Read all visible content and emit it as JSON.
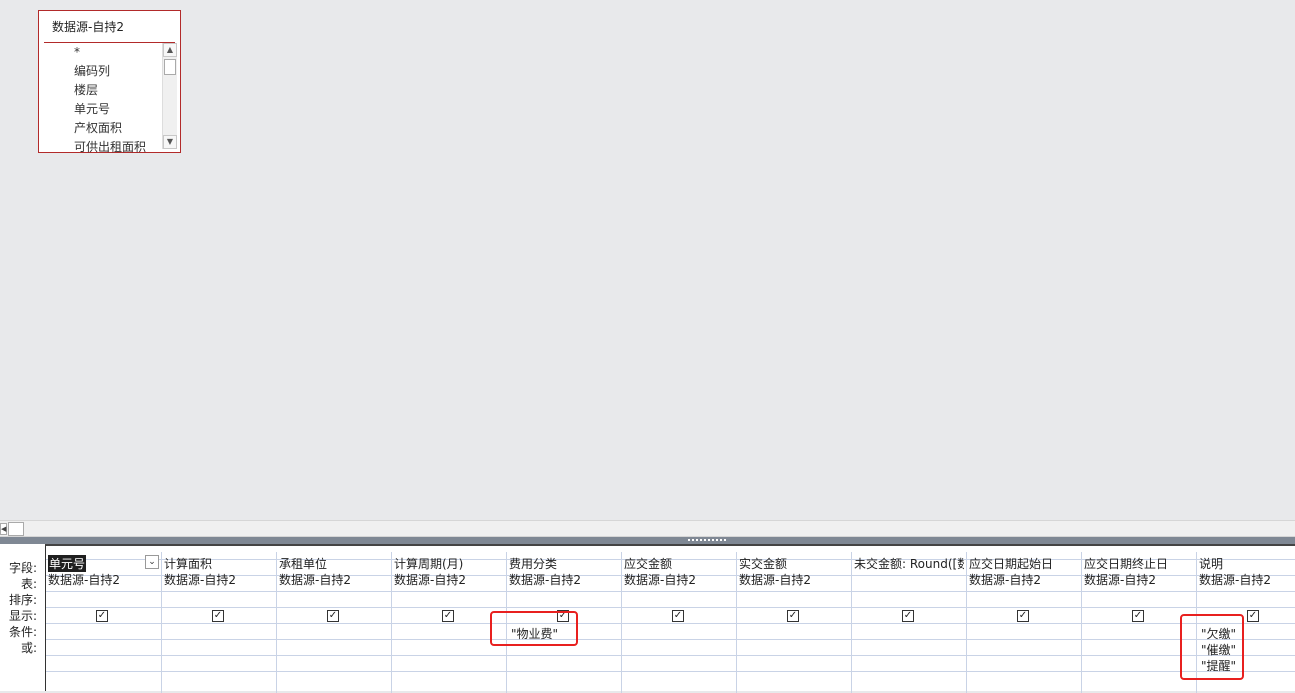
{
  "table_box": {
    "title": "数据源-自持2",
    "fields": [
      "*",
      "编码列",
      "楼层",
      "单元号",
      "产权面积",
      "可供出租面积"
    ]
  },
  "scroll": {
    "up": "▲",
    "down": "▼",
    "left": "◀"
  },
  "row_labels": [
    "字段:",
    "表:",
    "排序:",
    "显示:",
    "条件:",
    "或:"
  ],
  "columns": [
    {
      "field": "单元号",
      "table": "数据源-自持2",
      "show": true,
      "criteria": []
    },
    {
      "field": "计算面积",
      "table": "数据源-自持2",
      "show": true,
      "criteria": []
    },
    {
      "field": "承租单位",
      "table": "数据源-自持2",
      "show": true,
      "criteria": []
    },
    {
      "field": "计算周期(月)",
      "table": "数据源-自持2",
      "show": true,
      "criteria": []
    },
    {
      "field": "费用分类",
      "table": "数据源-自持2",
      "show": true,
      "criteria": [
        "\"物业费\""
      ]
    },
    {
      "field": "应交金额",
      "table": "数据源-自持2",
      "show": true,
      "criteria": []
    },
    {
      "field": "实交金额",
      "table": "数据源-自持2",
      "show": true,
      "criteria": []
    },
    {
      "field": "未交金额: Round([数",
      "table": "",
      "show": true,
      "criteria": []
    },
    {
      "field": "应交日期起始日",
      "table": "数据源-自持2",
      "show": true,
      "criteria": []
    },
    {
      "field": "应交日期终止日",
      "table": "数据源-自持2",
      "show": true,
      "criteria": []
    },
    {
      "field": "说明",
      "table": "数据源-自持2",
      "show": true,
      "criteria": [
        "\"欠缴\"",
        "\"催缴\"",
        "\"提醒\""
      ]
    }
  ],
  "checkmark": "✓",
  "dropdown_glyph": "⌄",
  "accent_colors": {
    "table_border": "#b22a2a",
    "highlight": "#e8201f",
    "grid_lines": "#c9d3e6"
  }
}
